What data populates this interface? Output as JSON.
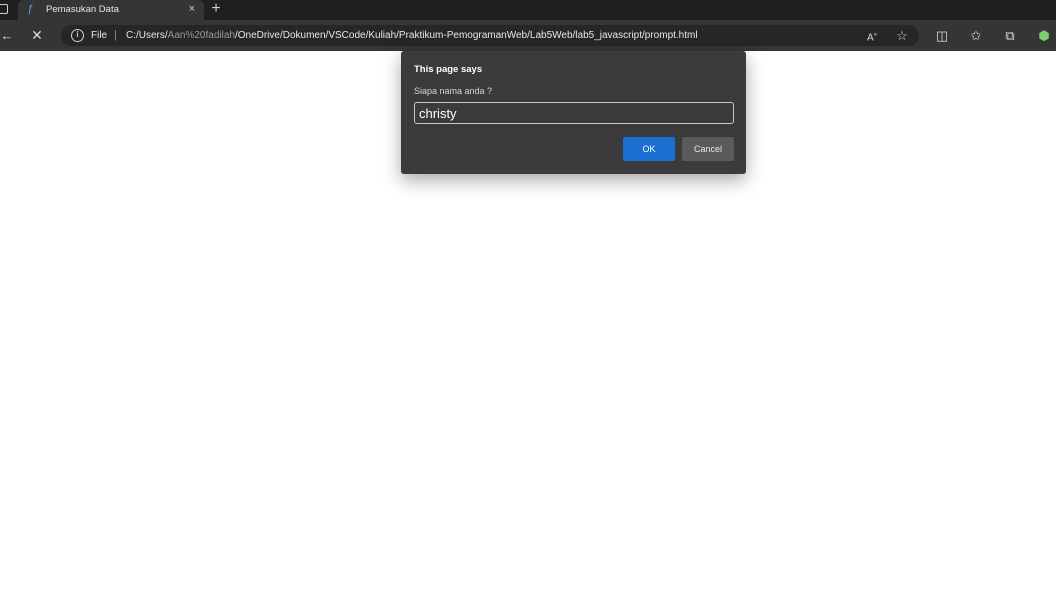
{
  "tab": {
    "title": "Pemasukan Data",
    "close_glyph": "×",
    "new_tab_glyph": "+"
  },
  "toolbar": {
    "back_glyph": "←",
    "stop_glyph": "✕",
    "info_glyph": "i",
    "scheme_label": "File",
    "separator": "|",
    "url_prefix": "C:/Users/",
    "url_user": "Aan%20fadilah",
    "url_rest": "/OneDrive/Dokumen/VSCode/Kuliah/Praktikum-PemogramanWeb/Lab5Web/lab5_javascript/prompt.html",
    "right_icons": [
      "read-aloud-icon",
      "favorite-star-icon",
      "split-screen-icon",
      "favorites-list-icon",
      "collections-icon",
      "extensions-icon"
    ]
  },
  "dialog": {
    "title": "This page says",
    "message": "Siapa nama anda ?",
    "input_value": "christy",
    "ok_label": "OK",
    "cancel_label": "Cancel"
  },
  "colors": {
    "tabstrip": "#1f1f1f",
    "toolbar": "#353535",
    "dialog_bg": "#3b3b3b",
    "ok_button": "#1a6fd1",
    "cancel_button": "#5a5a5a"
  }
}
